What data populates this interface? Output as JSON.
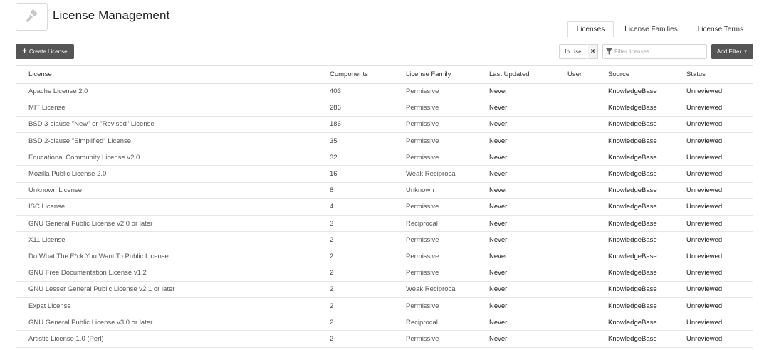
{
  "header": {
    "title": "License Management",
    "tabs": [
      {
        "label": "Licenses",
        "active": true
      },
      {
        "label": "License Families",
        "active": false
      },
      {
        "label": "License Terms",
        "active": false
      }
    ]
  },
  "toolbar": {
    "create_label": "Create License",
    "inuse_label": "In Use",
    "clear_symbol": "×",
    "filter_placeholder": "Filter licenses...",
    "add_filter_label": "Add Filter"
  },
  "table": {
    "columns": [
      "License",
      "Components",
      "License Family",
      "Last Updated",
      "User",
      "Source",
      "Status"
    ],
    "rows": [
      {
        "license": "Apache License 2.0",
        "components": "403",
        "family": "Permissive",
        "updated": "Never",
        "user": "",
        "source": "KnowledgeBase",
        "status": "Unreviewed"
      },
      {
        "license": "MIT License",
        "components": "286",
        "family": "Permissive",
        "updated": "Never",
        "user": "",
        "source": "KnowledgeBase",
        "status": "Unreviewed"
      },
      {
        "license": "BSD 3-clause \"New\" or \"Revised\" License",
        "components": "186",
        "family": "Permissive",
        "updated": "Never",
        "user": "",
        "source": "KnowledgeBase",
        "status": "Unreviewed"
      },
      {
        "license": "BSD 2-clause \"Simplified\" License",
        "components": "35",
        "family": "Permissive",
        "updated": "Never",
        "user": "",
        "source": "KnowledgeBase",
        "status": "Unreviewed"
      },
      {
        "license": "Educational Community License v2.0",
        "components": "32",
        "family": "Permissive",
        "updated": "Never",
        "user": "",
        "source": "KnowledgeBase",
        "status": "Unreviewed"
      },
      {
        "license": "Mozilla Public License 2.0",
        "components": "16",
        "family": "Weak Reciprocal",
        "updated": "Never",
        "user": "",
        "source": "KnowledgeBase",
        "status": "Unreviewed"
      },
      {
        "license": "Unknown License",
        "components": "8",
        "family": "Unknown",
        "updated": "Never",
        "user": "",
        "source": "KnowledgeBase",
        "status": "Unreviewed"
      },
      {
        "license": "ISC License",
        "components": "4",
        "family": "Permissive",
        "updated": "Never",
        "user": "",
        "source": "KnowledgeBase",
        "status": "Unreviewed"
      },
      {
        "license": "GNU General Public License v2.0 or later",
        "components": "3",
        "family": "Reciprocal",
        "updated": "Never",
        "user": "",
        "source": "KnowledgeBase",
        "status": "Unreviewed"
      },
      {
        "license": "X11 License",
        "components": "2",
        "family": "Permissive",
        "updated": "Never",
        "user": "",
        "source": "KnowledgeBase",
        "status": "Unreviewed"
      },
      {
        "license": "Do What The F*ck You Want To Public License",
        "components": "2",
        "family": "Permissive",
        "updated": "Never",
        "user": "",
        "source": "KnowledgeBase",
        "status": "Unreviewed"
      },
      {
        "license": "GNU Free Documentation License v1.2",
        "components": "2",
        "family": "Permissive",
        "updated": "Never",
        "user": "",
        "source": "KnowledgeBase",
        "status": "Unreviewed"
      },
      {
        "license": "GNU Lesser General Public License v2.1 or later",
        "components": "2",
        "family": "Weak Reciprocal",
        "updated": "Never",
        "user": "",
        "source": "KnowledgeBase",
        "status": "Unreviewed"
      },
      {
        "license": "Expat License",
        "components": "2",
        "family": "Permissive",
        "updated": "Never",
        "user": "",
        "source": "KnowledgeBase",
        "status": "Unreviewed"
      },
      {
        "license": "GNU General Public License v3.0 or later",
        "components": "2",
        "family": "Reciprocal",
        "updated": "Never",
        "user": "",
        "source": "KnowledgeBase",
        "status": "Unreviewed"
      },
      {
        "license": "Artistic License 1.0 (Perl)",
        "components": "2",
        "family": "Permissive",
        "updated": "Never",
        "user": "",
        "source": "KnowledgeBase",
        "status": "Unreviewed"
      }
    ]
  },
  "colors": {
    "button_dark": "#555555",
    "border": "#e1e1e1"
  },
  "icons": {
    "app": "gavel-icon",
    "create": "plus-icon",
    "filter": "funnel-icon",
    "dropdown": "caret-down-icon"
  }
}
